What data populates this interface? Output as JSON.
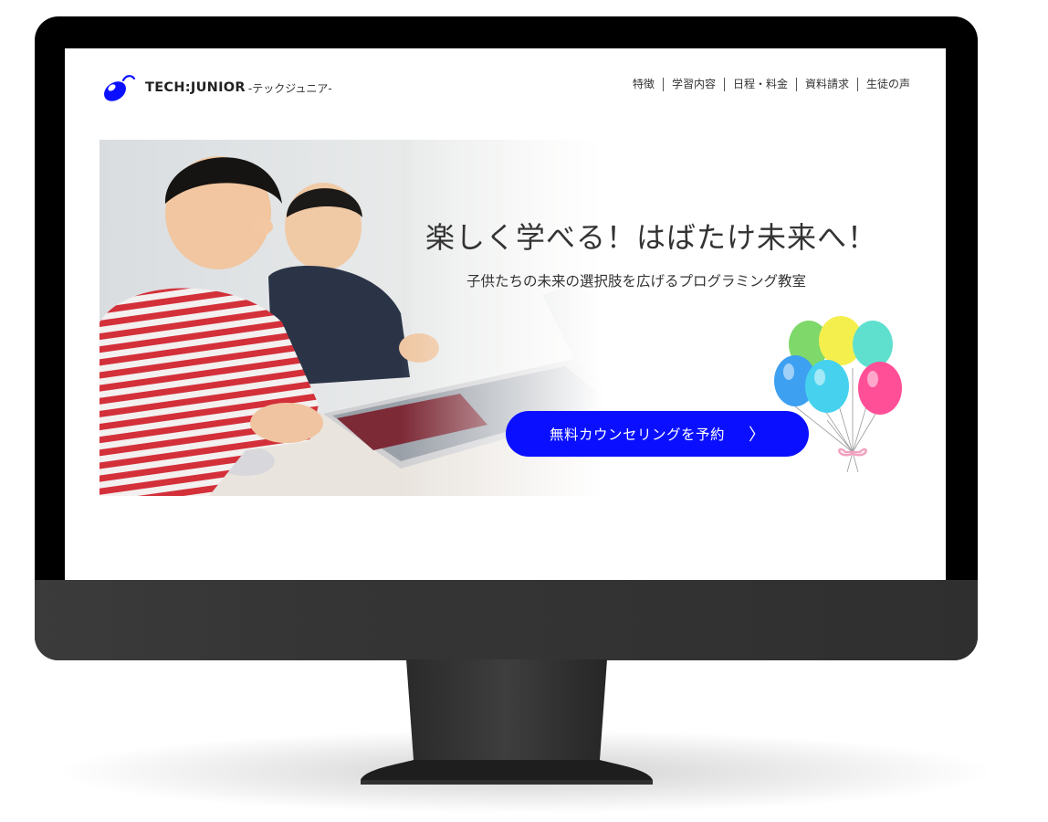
{
  "site": {
    "logo_name": "TECH:JUNIOR",
    "logo_sub": "-テックジュニア-",
    "nav": [
      {
        "label": "特徴"
      },
      {
        "label": "学習内容"
      },
      {
        "label": "日程・料金"
      },
      {
        "label": "資料請求"
      },
      {
        "label": "生徒の声"
      }
    ]
  },
  "hero": {
    "title": "楽しく学べる！はばたけ未来へ！",
    "subtitle": "子供たちの未来の選択肢を広げるプログラミング教室",
    "cta_label": "無料カウンセリングを予約",
    "cta_arrow": "〉"
  },
  "colors": {
    "accent": "#0a10ff",
    "bezel": "#000000",
    "chin": "#353535",
    "text": "#333333"
  },
  "icons": [
    "mouse-logo-icon",
    "chevron-right-icon",
    "balloons-illustration"
  ]
}
